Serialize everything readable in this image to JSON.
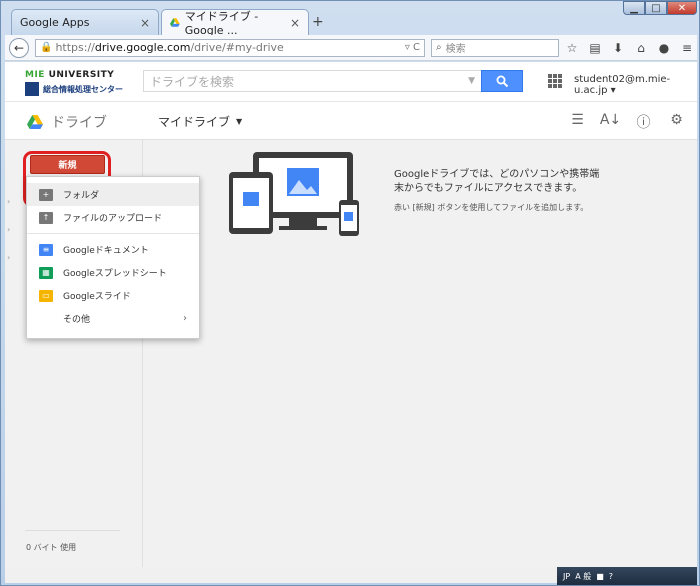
{
  "browser": {
    "tabs": [
      {
        "label": "Google Apps",
        "active": false
      },
      {
        "label": "マイドライブ - Google ...",
        "active": true
      }
    ],
    "newtab_label": "+",
    "url": {
      "prefix": "https://",
      "host": "drive.google.com",
      "path": "/drive/#my-drive"
    },
    "search_placeholder": "検索"
  },
  "header": {
    "logo_top_a": "MIE",
    "logo_top_b": "UNIVERSITY",
    "logo_text": "総合情報処理センター",
    "search_placeholder": "ドライブを検索",
    "account": "student02@m.mie-u.ac.jp"
  },
  "subheader": {
    "brand": "ドライブ",
    "title": "マイドライブ"
  },
  "sidebar": {
    "new_button": "新規",
    "usage": "0 バイト 使用"
  },
  "new_menu": {
    "items": [
      {
        "label": "フォルダ",
        "icon": "folder-plus-icon"
      },
      {
        "label": "ファイルのアップロード",
        "icon": "file-upload-icon"
      },
      {
        "label": "Googleドキュメント",
        "icon": "google-docs-icon"
      },
      {
        "label": "Googleスプレッドシート",
        "icon": "google-sheets-icon"
      },
      {
        "label": "Googleスライド",
        "icon": "google-slides-icon"
      },
      {
        "label": "その他",
        "icon": "more-chevron-icon"
      }
    ]
  },
  "empty_state": {
    "line1": "Googleドライブでは、どのパソコンや携帯端末からでもファイルにアクセスできます。",
    "line2": "赤い [新規] ボタンを使用してファイルを追加します。"
  },
  "tray": {
    "lang": "JP",
    "ime": "A 般"
  },
  "colors": {
    "new_button": "#d14836",
    "search_button": "#4d90fe",
    "highlight": "#e02020"
  }
}
